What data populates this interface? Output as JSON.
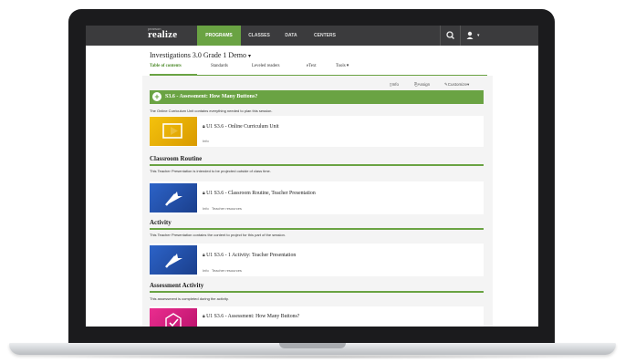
{
  "topnav": {
    "brand": "realize",
    "brand_sub": "pearson",
    "tabs": [
      {
        "label": "PROGRAMS",
        "active": true
      },
      {
        "label": "CLASSES",
        "active": false
      },
      {
        "label": "DATA",
        "active": false
      },
      {
        "label": "CENTERS",
        "active": false
      }
    ],
    "search_icon": "search-icon",
    "user_icon": "user-icon",
    "caret": "▾"
  },
  "program": {
    "title": "Investigations 3.0 Grade 1 Demo",
    "caret": "▾"
  },
  "subnav": [
    {
      "label": "Table of contents",
      "active": true
    },
    {
      "label": "Standards",
      "active": false
    },
    {
      "label": "Leveled readers",
      "active": false
    },
    {
      "label": "eText",
      "active": false
    },
    {
      "label": "Tools ▾",
      "active": false
    }
  ],
  "tools": {
    "info": "Info",
    "assign": "Assign",
    "customize": "Customize▾"
  },
  "session": {
    "title": "S3.6 - Assessment: How Many Buttons?",
    "description": "The Online Curriculum Unit contains everything needed to plan this session."
  },
  "items": [
    {
      "title": "U1 S3.6 - Online Curriculum Unit",
      "meta": "Info",
      "meta2": "",
      "thumb": "yellow"
    },
    {
      "title": "U1 S3.6 - Classroom Routine, Teacher Presentation",
      "meta": "Info",
      "meta2": "Teacher resources",
      "thumb": "blue"
    },
    {
      "title": "U1 S3.6 - 1 Activity: Teacher Presentation",
      "meta": "Info",
      "meta2": "Teacher resources",
      "thumb": "blue"
    },
    {
      "title": "U1 S3.6 - Assessment: How Many Buttons?",
      "meta": "",
      "meta2": "",
      "thumb": "pink"
    }
  ],
  "sections": [
    {
      "title": "Classroom Routine",
      "description": "This Teacher Presentation is intended to be projected outside of class time."
    },
    {
      "title": "Activity",
      "description": "This Teacher Presentation contains the content to project for this part of the session."
    },
    {
      "title": "Assessment Activity",
      "description": "This assessment is completed during the activity."
    }
  ],
  "colors": {
    "accent": "#6aa343",
    "nav": "#3b3b3d"
  }
}
